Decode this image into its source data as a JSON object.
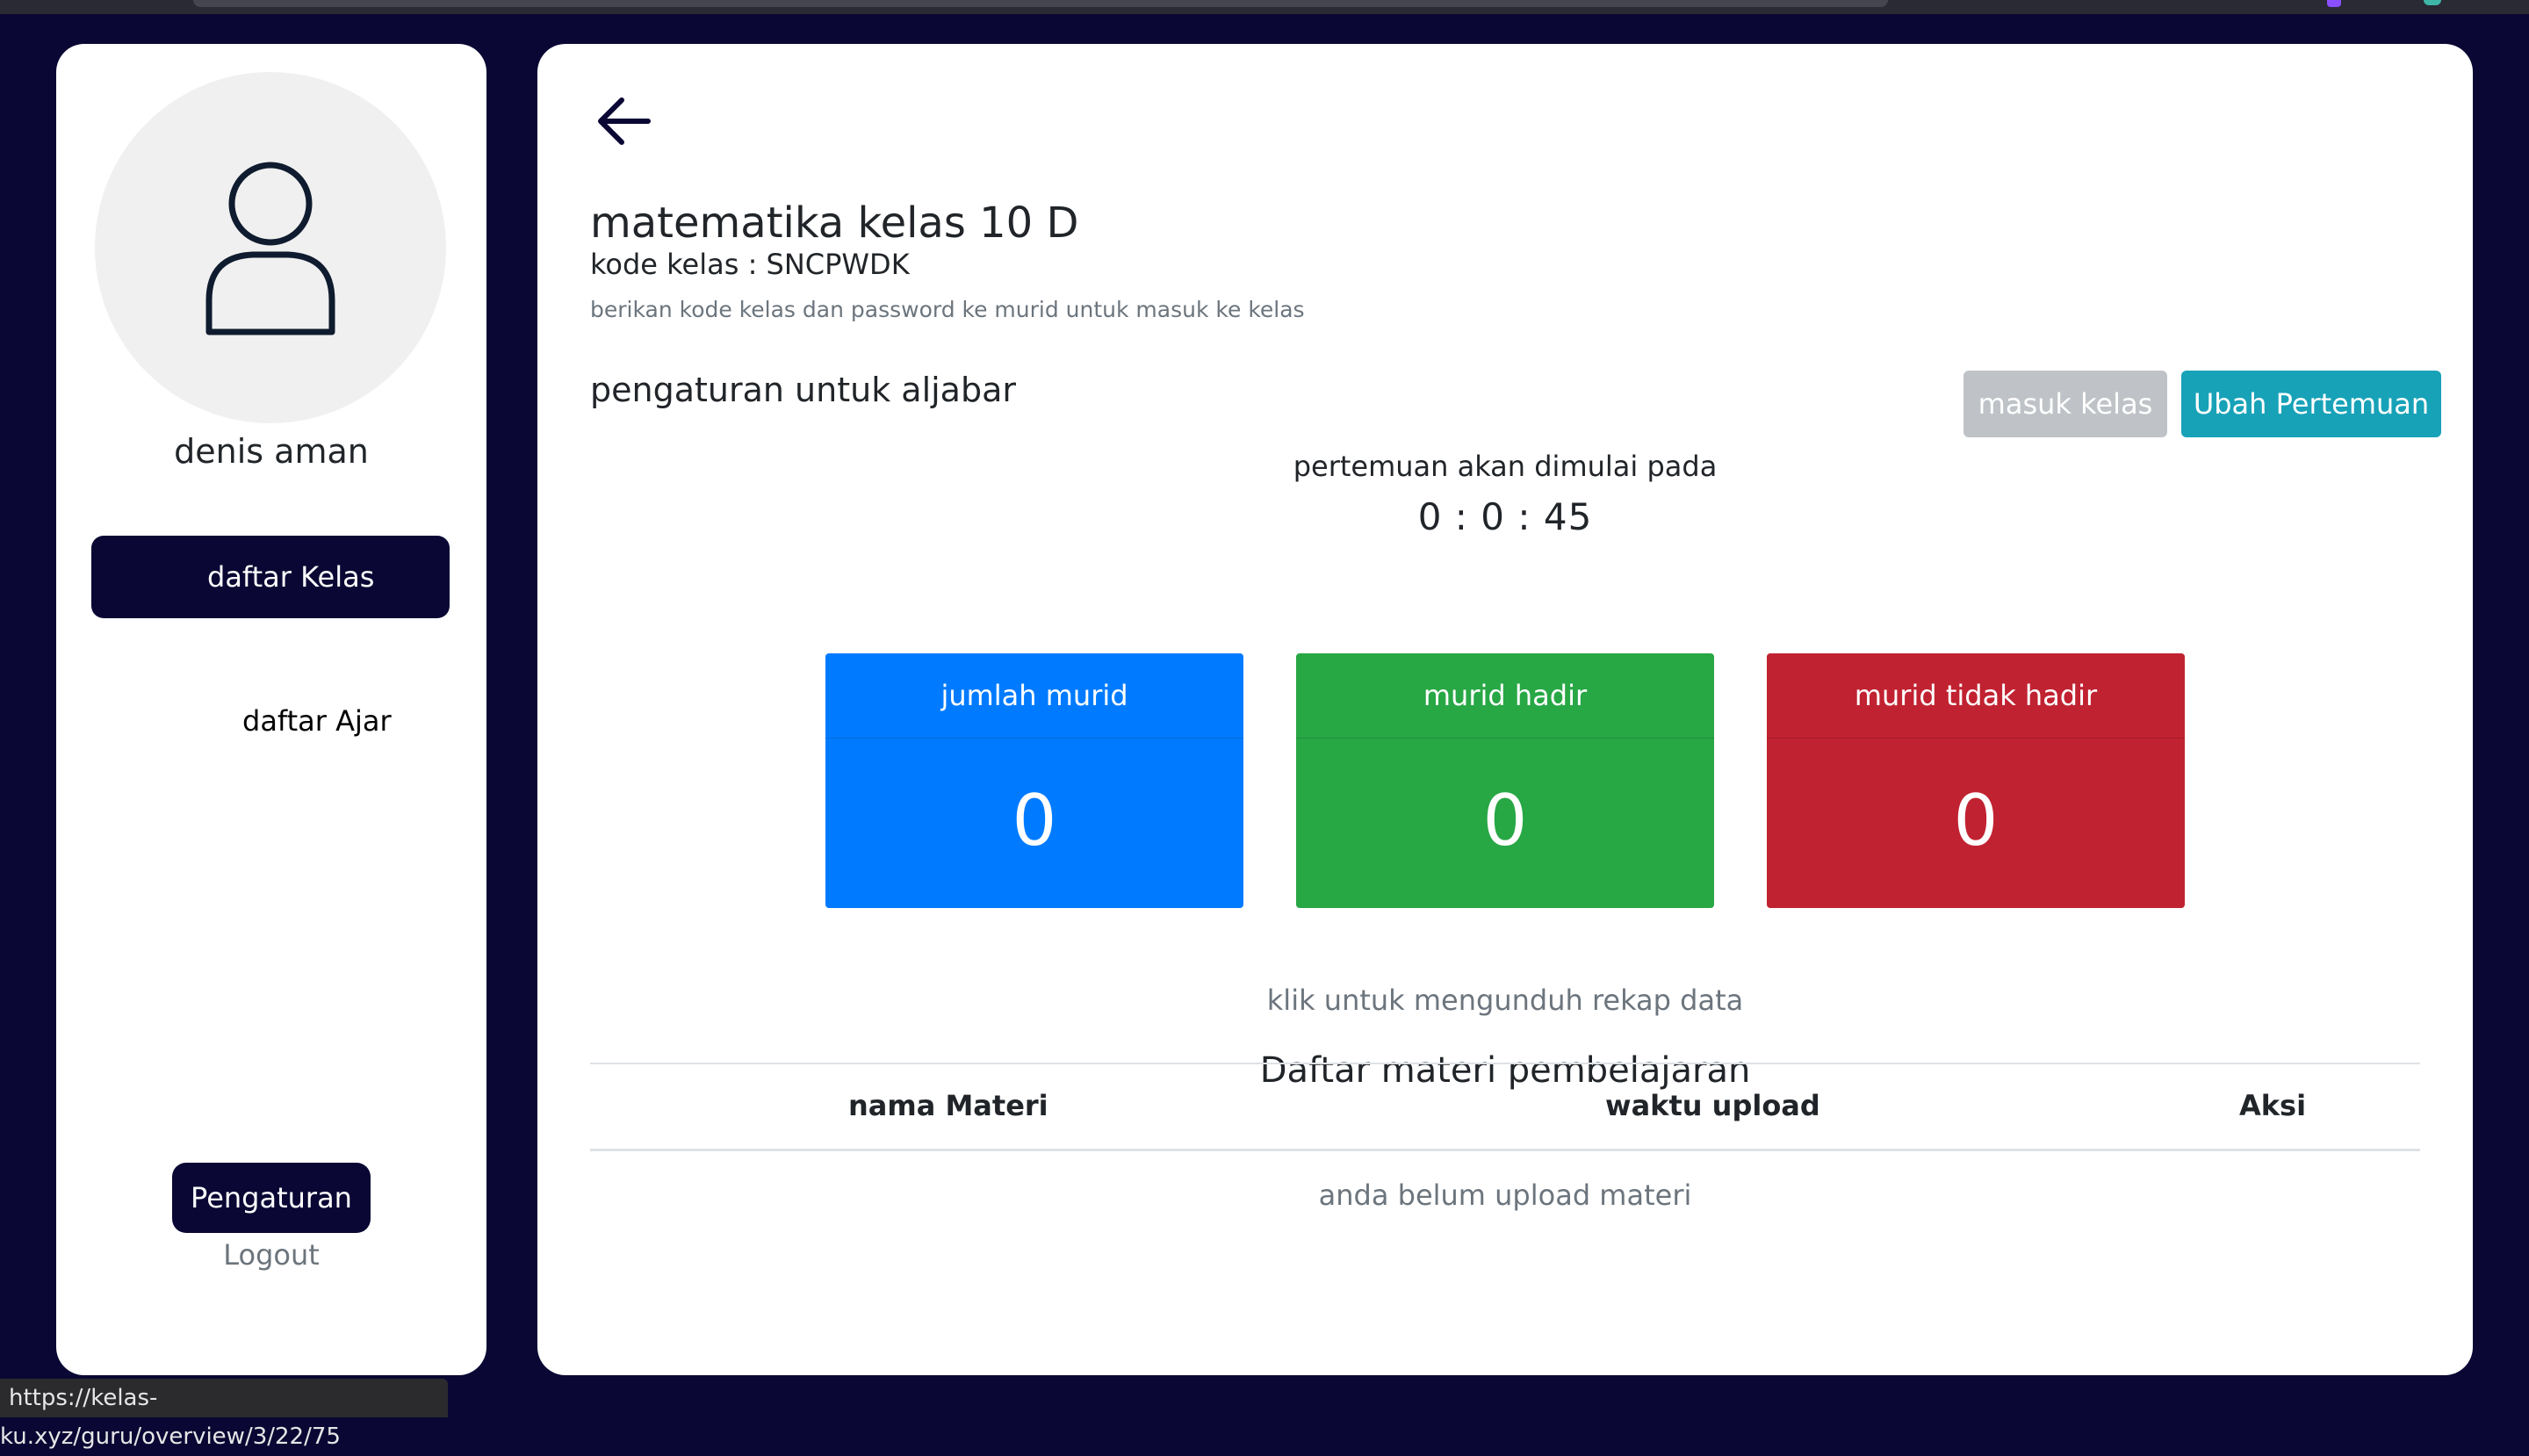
{
  "sidebar": {
    "user_name": "denis aman",
    "nav": [
      {
        "label": "daftar Kelas",
        "active": true
      },
      {
        "label": "daftar Ajar",
        "active": false
      }
    ],
    "settings_label": "Pengaturan",
    "logout_label": "Logout"
  },
  "class": {
    "title": "matematika kelas 10 D",
    "code_line": "kode kelas : SNCPWDK",
    "hint": "berikan kode kelas dan password ke murid untuk masuk ke kelas",
    "settings_heading": "pengaturan untuk aljabar"
  },
  "actions": {
    "enter_label": "masuk kelas",
    "change_label": "Ubah Pertemuan"
  },
  "meeting": {
    "label": "pertemuan akan dimulai pada",
    "countdown": "0 : 0 : 45"
  },
  "stats": [
    {
      "label": "jumlah murid",
      "value": "0",
      "color": "#007bff"
    },
    {
      "label": "murid hadir",
      "value": "0",
      "color": "#28a745"
    },
    {
      "label": "murid tidak hadir",
      "value": "0",
      "color": "#c12231"
    }
  ],
  "download_label": "klik untuk mengunduh rekap data",
  "materials": {
    "title": "Daftar materi pembelajaran",
    "columns": [
      "nama Materi",
      "waktu upload",
      "Aksi"
    ],
    "empty_text": "anda belum upload materi"
  },
  "status_url": "https://kelas-ku.xyz/guru/overview/3/22/75",
  "colors": {
    "background": "#0a0734",
    "accent": "#17a2b8",
    "disabled": "#bfc3c7"
  },
  "icons": [
    "user-avatar-icon",
    "arrow-left-icon"
  ]
}
